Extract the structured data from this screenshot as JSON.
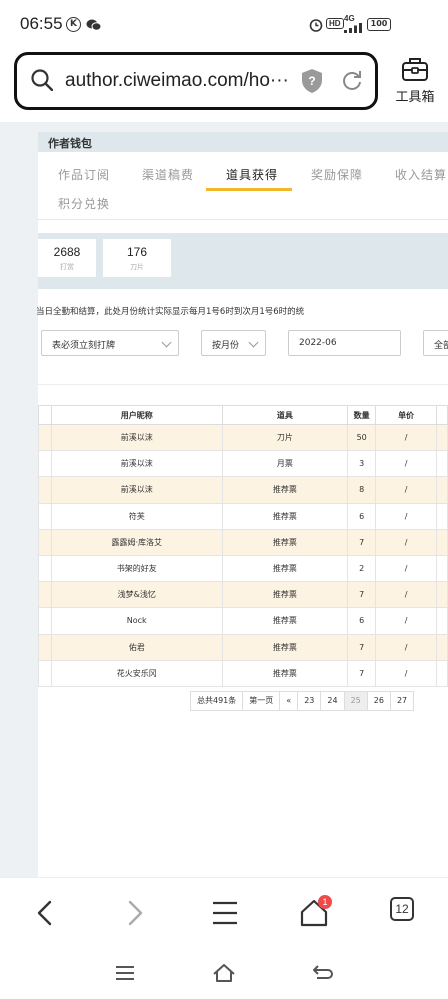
{
  "status": {
    "time": "06:55",
    "k_glyph": "K",
    "hd": "HD",
    "signal": "4G",
    "battery": "100"
  },
  "browser": {
    "url": "author.ciweimao.com/ho···",
    "toolbox_label": "工具箱",
    "tab_count": "12",
    "notification_count": "1"
  },
  "page": {
    "wallet_title": "作者钱包",
    "tabs": [
      "作品订阅",
      "渠道稿费",
      "道具获得",
      "奖励保障",
      "收入结算",
      "积分兑换"
    ],
    "active_tab": "道具获得",
    "stats": [
      {
        "value": "2688",
        "label": "打赏"
      },
      {
        "value": "176",
        "label": "刀片"
      }
    ],
    "notice": "当日全勤和结算，此处月份统计实际显示每月1号6时到次月1号6时的统",
    "filters": {
      "book": "表必须立刻打牌",
      "period": "按月份",
      "month": "2022-06",
      "all": "全部"
    },
    "table": {
      "headers": [
        "用户昵称",
        "道具",
        "数量",
        "单价"
      ],
      "rows": [
        [
          "前溪以沫",
          "刀片",
          "50",
          "/"
        ],
        [
          "前溪以沫",
          "月票",
          "3",
          "/"
        ],
        [
          "前溪以沫",
          "推荐票",
          "8",
          "/"
        ],
        [
          "符芙",
          "推荐票",
          "6",
          "/"
        ],
        [
          "露露姆·库洛艾",
          "推荐票",
          "7",
          "/"
        ],
        [
          "书架的好友",
          "推荐票",
          "2",
          "/"
        ],
        [
          "浅梦&浅忆",
          "推荐票",
          "7",
          "/"
        ],
        [
          "Nock",
          "推荐票",
          "6",
          "/"
        ],
        [
          "佑君",
          "推荐票",
          "7",
          "/"
        ],
        [
          "花火安乐冈",
          "推荐票",
          "7",
          "/"
        ]
      ]
    },
    "pager": {
      "total": "总共491条",
      "first": "第一页",
      "prev": "«",
      "pages": [
        "23",
        "24",
        "25",
        "26",
        "27"
      ],
      "current": "25"
    }
  },
  "icons": {
    "search": "search-icon",
    "shield": "shield-icon",
    "reload": "reload-icon",
    "toolbox": "toolbox-icon",
    "back": "back-icon",
    "forward": "forward-icon",
    "menu": "menu-icon",
    "home": "home-icon"
  }
}
